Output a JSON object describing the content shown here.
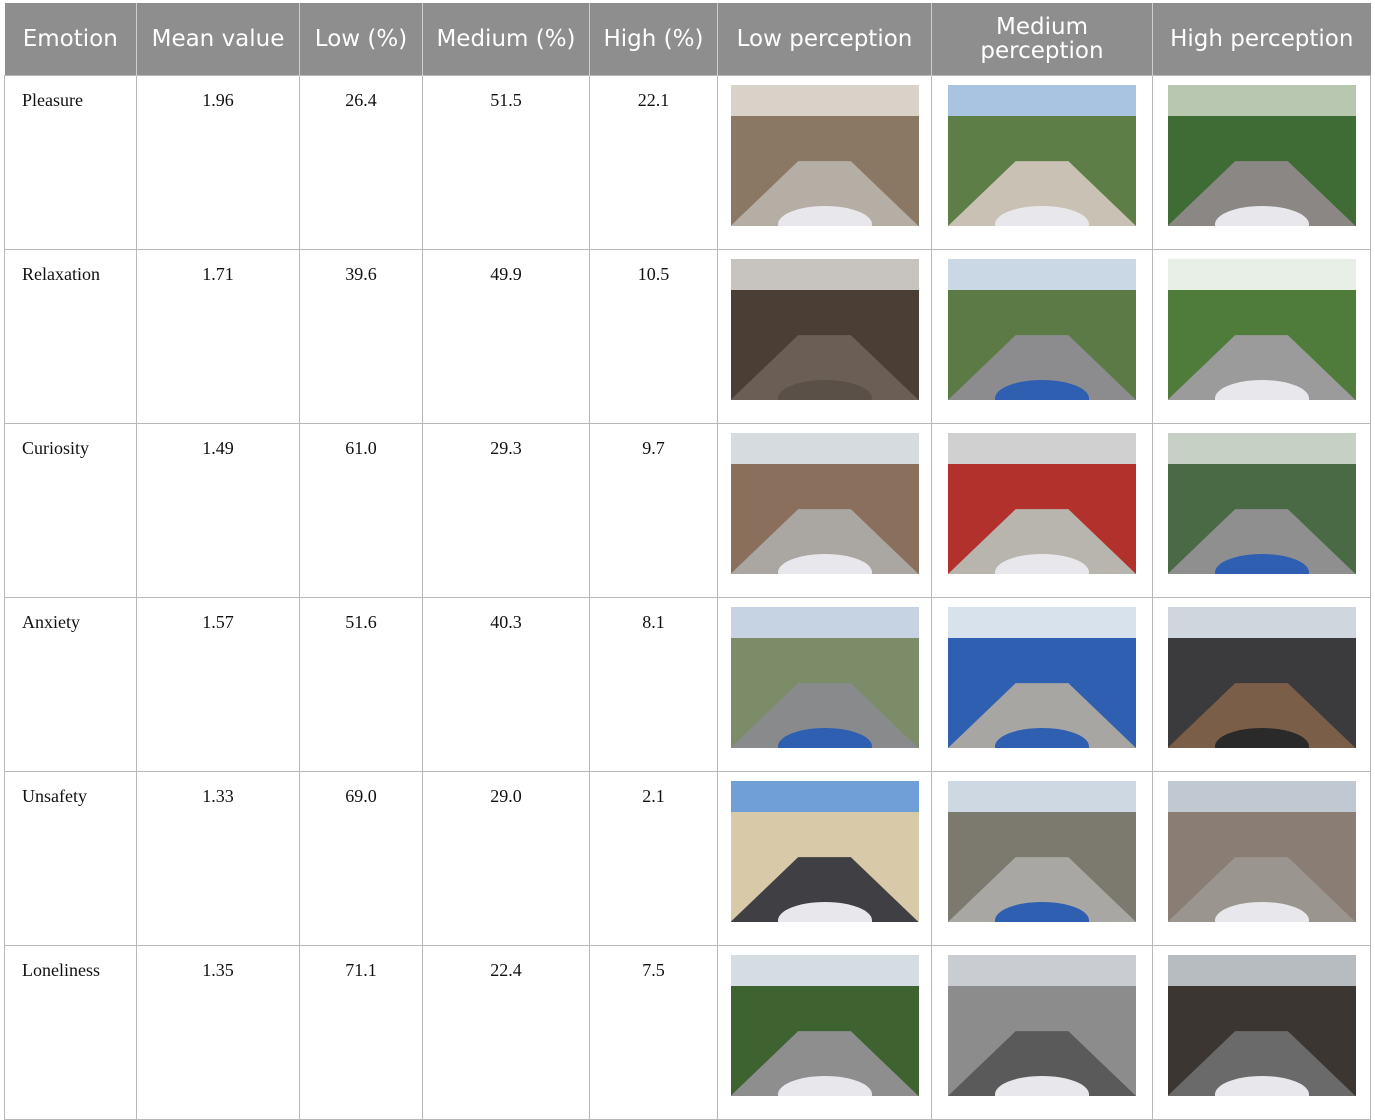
{
  "table": {
    "headers": [
      "Emotion",
      "Mean value",
      "Low (%)",
      "Medium (%)",
      "High (%)",
      "Low perception",
      "Medium perception",
      "High perception"
    ],
    "rows": [
      {
        "emotion": "Pleasure",
        "mean": "1.96",
        "low": "26.4",
        "medium": "51.5",
        "high": "22.1",
        "images": [
          {
            "sky": "#d8d2c8",
            "side": "#8a7864",
            "road": "#b5aea4",
            "car": "#e8e8ec"
          },
          {
            "sky": "#a8c4e0",
            "side": "#5e7e48",
            "road": "#c9c2b4",
            "car": "#e8e8ec"
          },
          {
            "sky": "#b8c8b0",
            "side": "#3f6b35",
            "road": "#8a8784",
            "car": "#e8e8ec"
          }
        ]
      },
      {
        "emotion": "Relaxation",
        "mean": "1.71",
        "low": "39.6",
        "medium": "49.9",
        "high": "10.5",
        "images": [
          {
            "sky": "#c7c4bf",
            "side": "#4a3e35",
            "road": "#6b5f55",
            "car": "#5a5048"
          },
          {
            "sky": "#cad8e6",
            "side": "#5b7a46",
            "road": "#8c8c8e",
            "car": "#2f5fb0"
          },
          {
            "sky": "#e8efe6",
            "side": "#4f7c3b",
            "road": "#9b9b9b",
            "car": "#e8e8ec"
          }
        ]
      },
      {
        "emotion": "Curiosity",
        "mean": "1.49",
        "low": "61.0",
        "medium": "29.3",
        "high": "9.7",
        "images": [
          {
            "sky": "#d6dbe0",
            "side": "#8a6f5c",
            "road": "#aaa7a3",
            "car": "#e8e8ec"
          },
          {
            "sky": "#d0d0d0",
            "side": "#b3312c",
            "road": "#b8b4ae",
            "car": "#e8e8ec"
          },
          {
            "sky": "#c7d0c5",
            "side": "#4a6a45",
            "road": "#8f8f8f",
            "car": "#2f5fb0"
          }
        ]
      },
      {
        "emotion": "Anxiety",
        "mean": "1.57",
        "low": "51.6",
        "medium": "40.3",
        "high": "8.1",
        "images": [
          {
            "sky": "#c5d3e2",
            "side": "#7d8c68",
            "road": "#888a8c",
            "car": "#2f5fb0"
          },
          {
            "sky": "#d8e2ec",
            "side": "#2f5fb0",
            "road": "#a8a6a2",
            "car": "#2f5fb0"
          },
          {
            "sky": "#cfd6dd",
            "side": "#3b3b3e",
            "road": "#7a5e48",
            "car": "#2a2a2a"
          }
        ]
      },
      {
        "emotion": "Unsafety",
        "mean": "1.33",
        "low": "69.0",
        "medium": "29.0",
        "high": "2.1",
        "images": [
          {
            "sky": "#6f9fd6",
            "side": "#d8c9a8",
            "road": "#3f3f44",
            "car": "#e8e8ec"
          },
          {
            "sky": "#cdd8e2",
            "side": "#7c7a6e",
            "road": "#a9a7a3",
            "car": "#2f5fb0"
          },
          {
            "sky": "#c0c8d2",
            "side": "#8a7e74",
            "road": "#9a958e",
            "car": "#e8e8ec"
          }
        ]
      },
      {
        "emotion": "Loneliness",
        "mean": "1.35",
        "low": "71.1",
        "medium": "22.4",
        "high": "7.5",
        "images": [
          {
            "sky": "#d5dde3",
            "side": "#3f6330",
            "road": "#8e8e8e",
            "car": "#e8e8ec"
          },
          {
            "sky": "#c9cdd2",
            "side": "#8c8c8c",
            "road": "#5a5a5a",
            "car": "#e8e8ec"
          },
          {
            "sky": "#b7bcc0",
            "side": "#3b3631",
            "road": "#6a6a6a",
            "car": "#e8e8ec"
          }
        ]
      }
    ]
  }
}
